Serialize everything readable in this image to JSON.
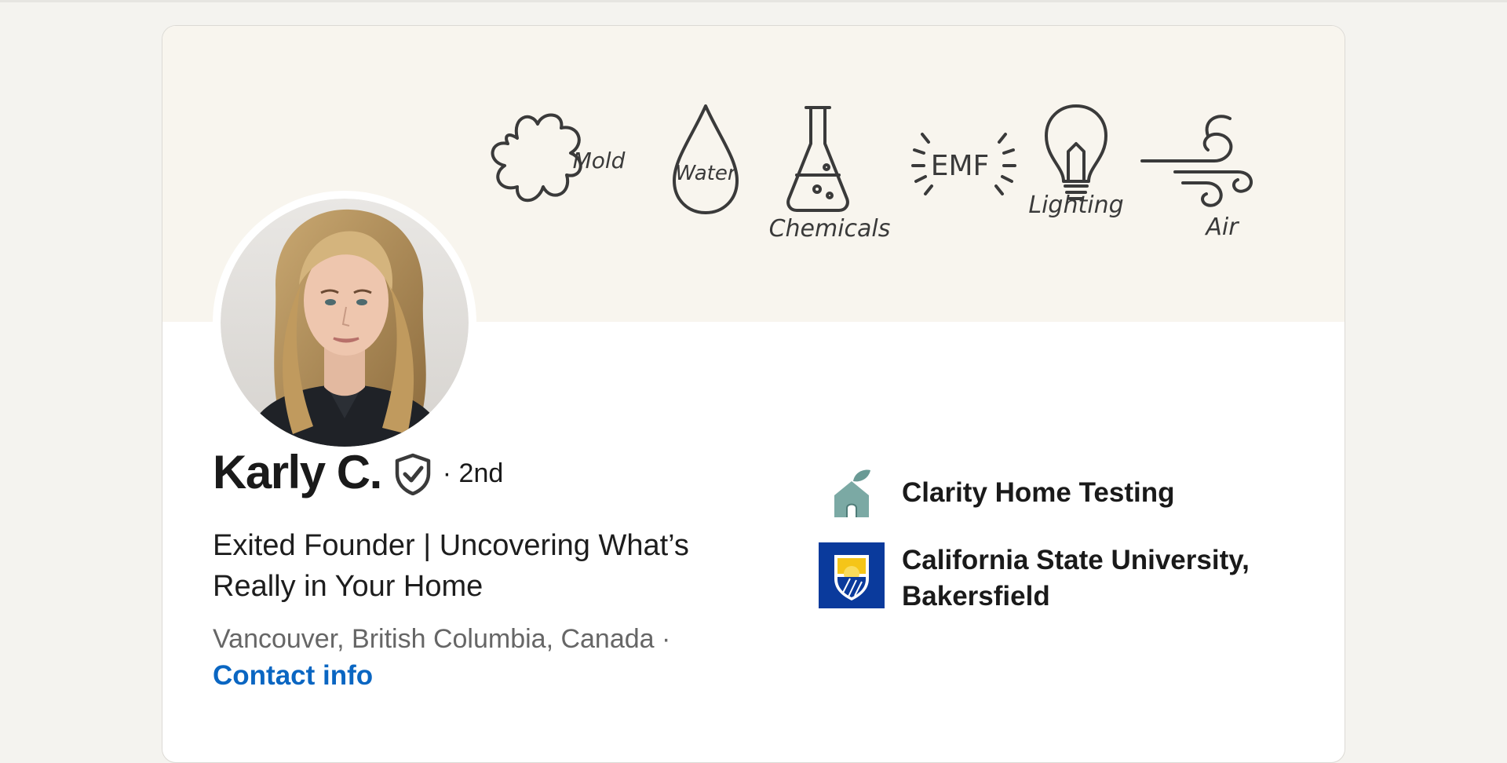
{
  "banner": {
    "labels": [
      "Mold",
      "Water",
      "Chemicals",
      "EMF",
      "Lighting",
      "Air"
    ],
    "background": "#f8f5ee"
  },
  "profile": {
    "name": "Karly C.",
    "verified_icon": "shield-check-icon",
    "connection_degree": "· 2nd",
    "headline": "Exited Founder | Uncovering What’s Really in Your Home",
    "location": "Vancouver, British Columbia, Canada ·",
    "contact_link": "Contact info"
  },
  "organizations": [
    {
      "name": "Clarity Home Testing",
      "logo": "house-leaf-logo"
    },
    {
      "name": "California State University, Bakersfield",
      "logo": "csub-crest-logo"
    }
  ],
  "colors": {
    "link": "#0a66c2",
    "page_bg": "#f4f3ef",
    "company_logo": "#7ba9a4",
    "university_logo": "#0a3a9c",
    "university_accent": "#f5c518"
  }
}
